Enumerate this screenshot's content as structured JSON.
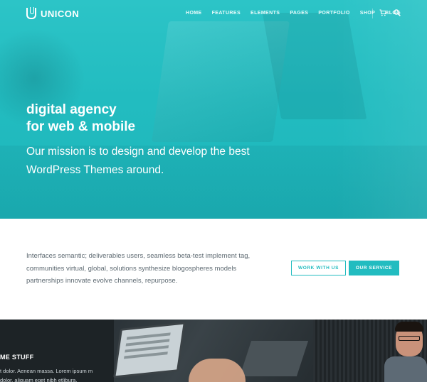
{
  "brand": {
    "name": "UNICON",
    "accent": "#22bcc0"
  },
  "nav": {
    "items": [
      {
        "label": "HOME"
      },
      {
        "label": "FEATURES"
      },
      {
        "label": "ELEMENTS"
      },
      {
        "label": "PAGES"
      },
      {
        "label": "PORTFOLIO"
      },
      {
        "label": "SHOP"
      },
      {
        "label": "BLOG"
      }
    ],
    "icons": [
      "cart-icon",
      "search-icon"
    ]
  },
  "hero": {
    "headline_line1": "digital agency",
    "headline_line2": "for web & mobile",
    "mission_line1": "Our mission is to design and develop the best",
    "mission_line2": "WordPress Themes around."
  },
  "intro": {
    "text": "Interfaces semantic; deliverables users, seamless beta-test implement tag, communities virtual, global, solutions synthesize blogospheres models partnerships innovate evolve channels, repurpose.",
    "work_button": "WORK WITH US",
    "service_button": "OUR SERVICE"
  },
  "feature": {
    "title": "ME STUFF",
    "text": "t dolor. Aenean massa. Lorem ipsum m dolor, aliquam eget nibh etlibura."
  }
}
